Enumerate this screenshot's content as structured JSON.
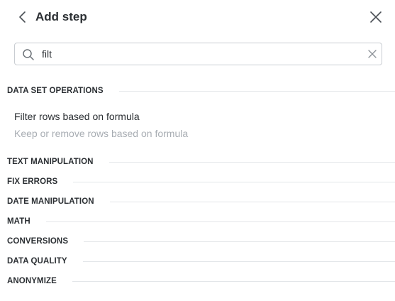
{
  "header": {
    "title": "Add step",
    "back_icon": "chevron-left-icon",
    "close_icon": "close-icon"
  },
  "search": {
    "value": "filt",
    "placeholder": "",
    "icon": "search-icon",
    "clear_icon": "clear-icon"
  },
  "sections": [
    {
      "label": "DATA SET OPERATIONS"
    },
    {
      "label": "TEXT MANIPULATION"
    },
    {
      "label": "FIX ERRORS"
    },
    {
      "label": "DATE MANIPULATION"
    },
    {
      "label": "MATH"
    },
    {
      "label": "CONVERSIONS"
    },
    {
      "label": "DATA QUALITY"
    },
    {
      "label": "ANONYMIZE"
    }
  ],
  "results": [
    {
      "title": "Filter rows based on formula",
      "description": "Keep or remove rows based on formula"
    }
  ],
  "colors": {
    "text": "#2b2f33",
    "muted_text": "#a8adb3",
    "border": "#c9cdd2",
    "rule": "#e3e6e9"
  }
}
